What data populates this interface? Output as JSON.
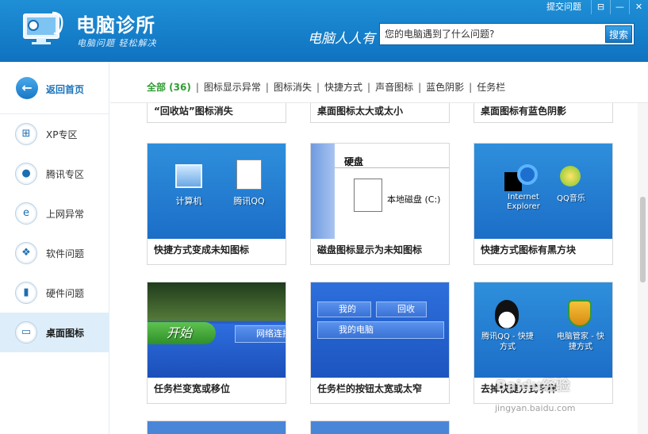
{
  "header": {
    "app_name": "电脑诊所",
    "slogan": "电脑问题 轻松解决",
    "tagline": "电脑人人有",
    "search_placeholder": "您的电脑遇到了什么问题?",
    "search_button": "搜索",
    "feedback": "提交问题",
    "menu_glyph": "⊟",
    "minimize_glyph": "—",
    "close_glyph": "✕"
  },
  "sidebar": {
    "back_label": "返回首页",
    "items": [
      {
        "label": "XP专区",
        "icon": "windows-icon",
        "glyph": "⊞"
      },
      {
        "label": "腾讯专区",
        "icon": "qq-penguin-icon",
        "glyph": "●"
      },
      {
        "label": "上网异常",
        "icon": "ie-browser-icon",
        "glyph": "e"
      },
      {
        "label": "软件问题",
        "icon": "software-icon",
        "glyph": "❖"
      },
      {
        "label": "硬件问题",
        "icon": "hardware-icon",
        "glyph": "▮"
      },
      {
        "label": "桌面图标",
        "icon": "desktop-icon",
        "glyph": "▭",
        "active": true
      }
    ]
  },
  "tabs": [
    {
      "label": "全部 (36)",
      "active": true
    },
    {
      "label": "图标显示异常"
    },
    {
      "label": "图标消失"
    },
    {
      "label": "快捷方式"
    },
    {
      "label": "声音图标"
    },
    {
      "label": "蓝色阴影"
    },
    {
      "label": "任务栏"
    }
  ],
  "cards": {
    "row0": [
      "“回收站”图标消失",
      "桌面图标太大或太小",
      "桌面图标有蓝色阴影"
    ],
    "row1": [
      "快捷方式变成未知图标",
      "磁盘图标显示为未知图标",
      "快捷方式图标有黑方块"
    ],
    "row2": [
      "任务栏变宽或移位",
      "任务栏的按钮太宽或太窄",
      "去掉快捷方式字样"
    ]
  },
  "thumbs": {
    "computer": "计算机",
    "qq": "腾讯QQ",
    "disk_title": "硬盘",
    "local_disk": "本地磁盘 (C:)",
    "ie": "Internet Explorer",
    "qqmusic": "QQ音乐",
    "start": "开始",
    "network": "网络连接",
    "my": "我的",
    "recycle": "回收",
    "mycomputer": "我的电脑",
    "qq_shortcut": "腾讯QQ - 快捷方式",
    "guard_shortcut": "电脑管家 - 快捷方式"
  },
  "watermark": {
    "text": "Baidu经验",
    "url": "jingyan.baidu.com"
  },
  "colors": {
    "header": "#1478c3",
    "active_tab": "#2f9d32",
    "active_nav_bg": "#ddeefa"
  }
}
